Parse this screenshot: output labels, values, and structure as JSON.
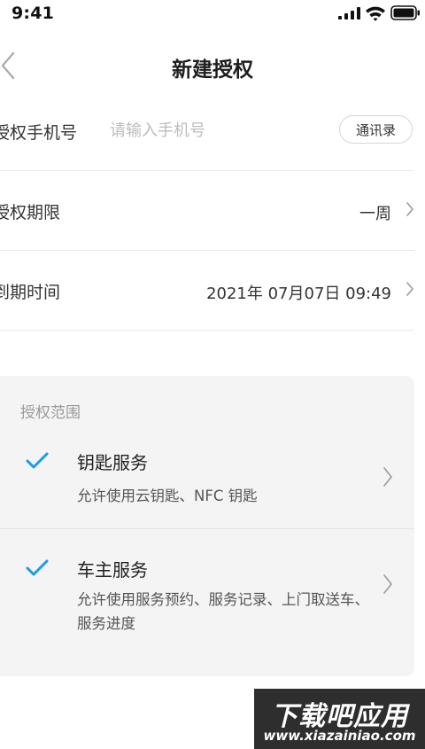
{
  "status_bar": {
    "time": "9:41"
  },
  "nav": {
    "title": "新建授权"
  },
  "form": {
    "phone": {
      "label": "授权手机号",
      "placeholder": "请输入手机号",
      "value": "",
      "contacts_button": "通讯录"
    },
    "duration": {
      "label": "授权期限",
      "value": "一周"
    },
    "expiry": {
      "label": "到期时间",
      "value": "2021年 07月07日 09:49"
    }
  },
  "scope": {
    "title": "授权范围",
    "items": [
      {
        "name": "钥匙服务",
        "description": "允许使用云钥匙、NFC 钥匙",
        "checked": true
      },
      {
        "name": "车主服务",
        "description": "允许使用服务预约、服务记录、上门取送车、服务进度",
        "checked": true
      }
    ]
  },
  "colors": {
    "accent": "#1a9de6",
    "card_background": "#f4f4f4",
    "divider": "#e9e9e9"
  },
  "icons": [
    "signal-icon",
    "wifi-icon",
    "battery-icon",
    "back-icon",
    "chevron-right-icon",
    "checkmark-icon"
  ],
  "watermark": {
    "title": "下载吧应用",
    "url": "www.xiazainiao.com"
  }
}
